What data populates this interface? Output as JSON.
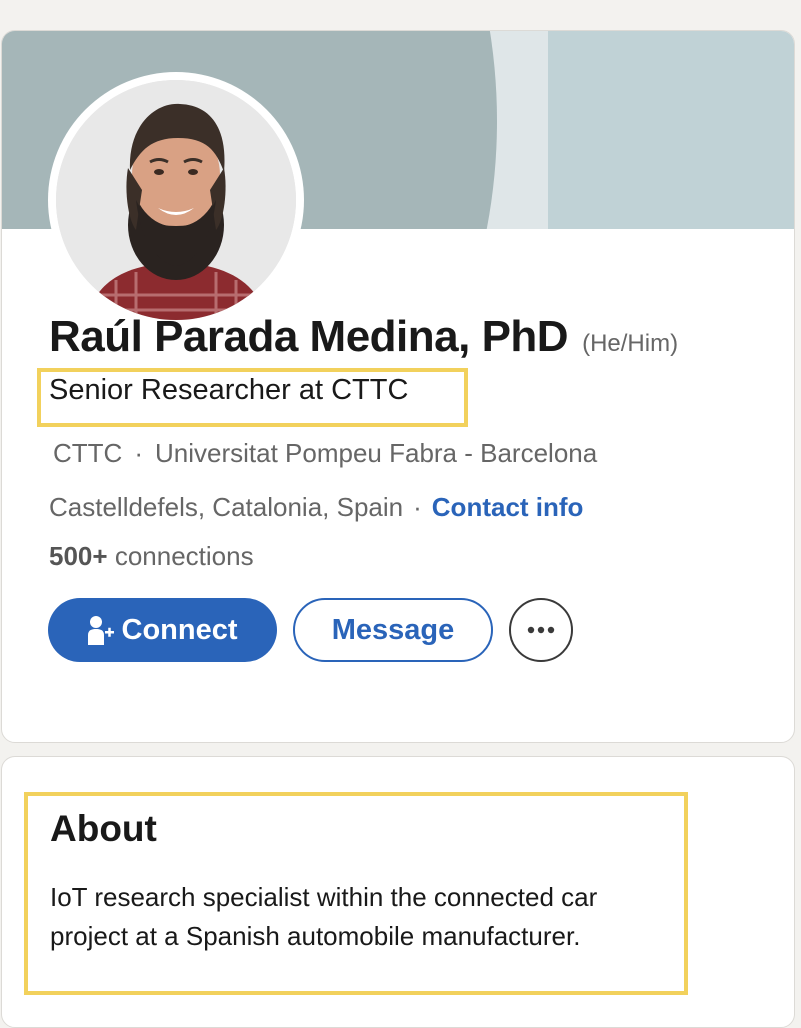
{
  "profile": {
    "name": "Raúl Parada Medina, PhD",
    "pronouns": "(He/Him)",
    "headline": "Senior Researcher at CTTC",
    "organizations": [
      "CTTC",
      "Universitat Pompeu Fabra - Barcelona"
    ],
    "separator": "·",
    "location": "Castelldefels, Catalonia, Spain",
    "contact_info_label": "Contact info",
    "connections_count": "500+",
    "connections_label": "connections"
  },
  "actions": {
    "connect_label": "Connect",
    "message_label": "Message",
    "more_label": "···"
  },
  "about": {
    "title": "About",
    "lines": [
      "IoT research specialist within the connected car",
      "project at a Spanish automobile manufacturer."
    ]
  },
  "icons": {
    "connect": "add-person-icon",
    "more": "more-horizontal-icon"
  },
  "colors": {
    "accent": "#2a64b9",
    "highlight": "#f2d15c",
    "banner": "#c0d2d6",
    "banner_arc": "#a5b6b8"
  }
}
